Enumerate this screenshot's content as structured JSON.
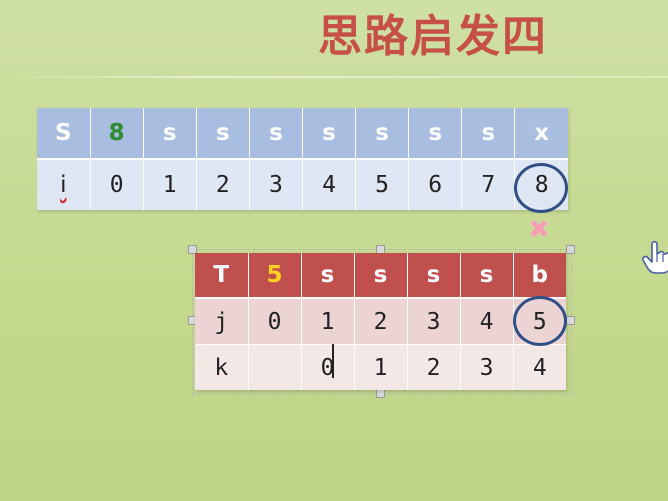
{
  "slide": {
    "title": "思路启发四"
  },
  "table_s": {
    "row_s": [
      "S",
      "8",
      "s",
      "s",
      "s",
      "s",
      "s",
      "s",
      "s",
      "x"
    ],
    "row_i": [
      "i",
      "0",
      "1",
      "2",
      "3",
      "4",
      "5",
      "6",
      "7",
      "8"
    ]
  },
  "table_t": {
    "row_t": [
      "T",
      "5",
      "s",
      "s",
      "s",
      "s",
      "b"
    ],
    "row_j": [
      "j",
      "0",
      "1",
      "2",
      "3",
      "4",
      "5"
    ],
    "row_k": [
      "k",
      "",
      "0",
      "1",
      "2",
      "3",
      "4"
    ]
  },
  "marks": {
    "mismatch_symbol": "✖"
  },
  "colors": {
    "title": "#c65046",
    "s_header": "#a9bde0",
    "t_header": "#c0504d",
    "highlight_green": "#2e8b2e",
    "highlight_yellow": "#ffd21e",
    "circle": "#2f4f86"
  }
}
